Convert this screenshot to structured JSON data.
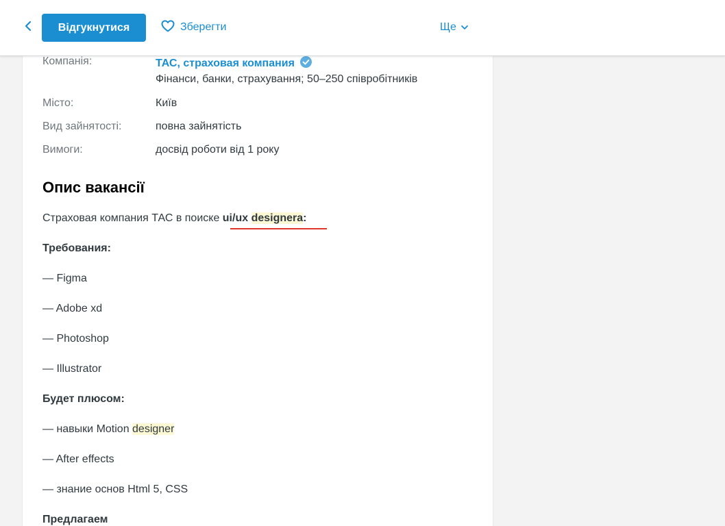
{
  "header": {
    "apply_label": "Відгукнутися",
    "save_label": "Зберегти",
    "more_label": "Ще"
  },
  "info": {
    "company_label": "Компанія:",
    "company_name": "ТАС, страховая компания",
    "company_details": "Фінанси, банки, страхування; 50–250 співробітників",
    "city_label": "Місто:",
    "city_value": "Київ",
    "employment_label": "Вид зайнятості:",
    "employment_value": "повна зайнятість",
    "requirements_label": "Вимоги:",
    "requirements_value": "досвід роботи від 1 року"
  },
  "description": {
    "title": "Опис вакансії",
    "intro_prefix": "Страховая компания ТАС в поиске ",
    "intro_ui": "ui/ux ",
    "intro_designera": "designera",
    "intro_colon": ":",
    "requirements_heading": "Требования:",
    "requirements": [
      "— Figma",
      "— Adobe xd",
      "— Photoshop",
      "— Illustrator"
    ],
    "plus_heading": "Будет плюсом:",
    "plus_item1_prefix": "— навыки Motion ",
    "plus_item1_hl": "designer",
    "plus_items": [
      "— After effects",
      "— знание основ Html 5, CSS"
    ],
    "offer_heading": "Предлагаем"
  },
  "colors": {
    "accent": "#1a8ed1",
    "highlight": "#fbf8d3",
    "underline": "#e0352b"
  }
}
